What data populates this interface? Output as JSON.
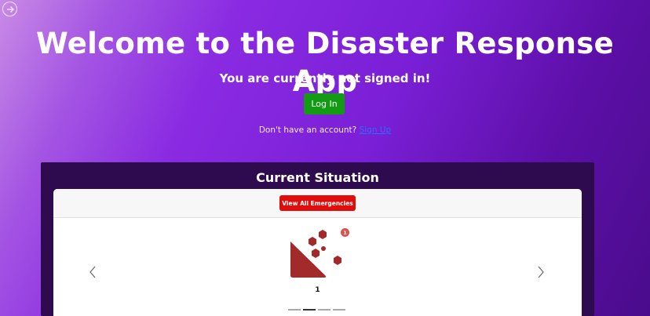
{
  "header": {
    "title": "Welcome to the Disaster Response App",
    "subtitle": "You are currently not signed in!",
    "login_label": "Log In",
    "signup_prompt": "Don't have an account?",
    "signup_link": "Sign Up",
    "back_icon": "arrow-right-circle-icon"
  },
  "situation": {
    "title": "Current Situation",
    "view_all_label": "View All Emergencies",
    "carousel": {
      "items": [
        {
          "icon": "landslide-icon",
          "badge": "1",
          "count": "1"
        }
      ],
      "active_index": 1,
      "indicator_count": 4,
      "prev_icon": "chevron-left-icon",
      "next_icon": "chevron-right-icon"
    }
  },
  "colors": {
    "login": "#139c13",
    "view_all": "#e00d0d",
    "hazard": "#a32a2a",
    "badge": "#d9534f",
    "panel": "#2e0a4f"
  }
}
